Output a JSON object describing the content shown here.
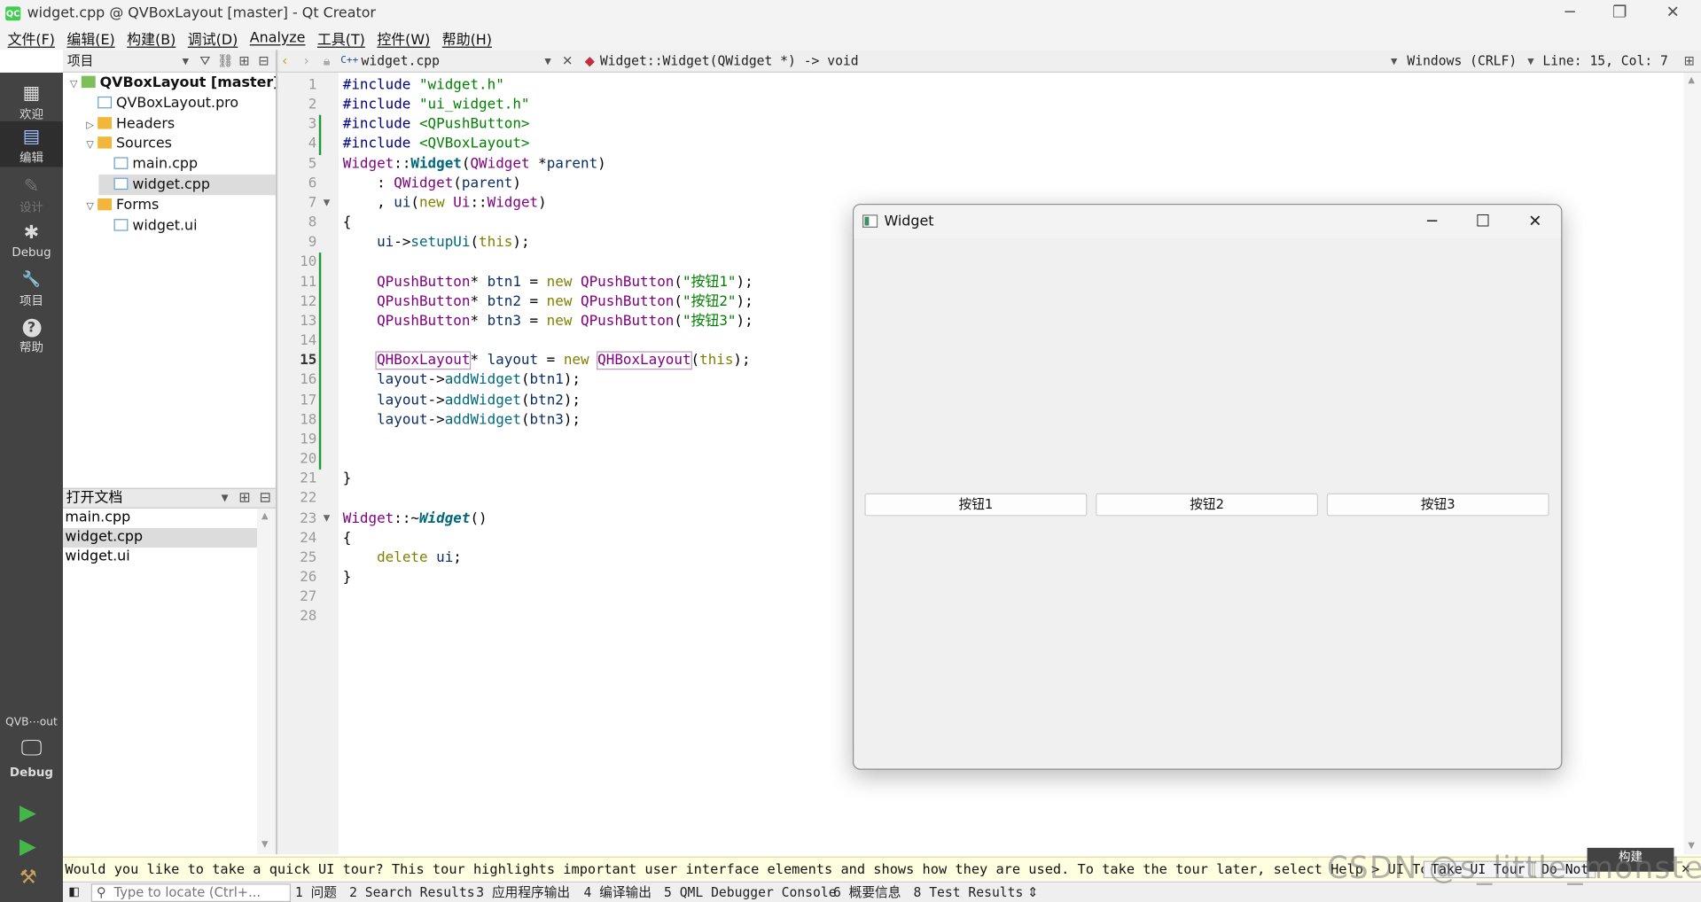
{
  "window": {
    "title": "widget.cpp @ QVBoxLayout [master] - Qt Creator",
    "logo": "QC",
    "min": "─",
    "max": "❐",
    "close": "✕"
  },
  "menu": [
    "文件(F)",
    "编辑(E)",
    "构建(B)",
    "调试(D)",
    "Analyze",
    "工具(T)",
    "控件(W)",
    "帮助(H)"
  ],
  "toolbar": {
    "panel": "项目",
    "file": "widget.cpp",
    "symbol": "Widget::Widget(QWidget *) -> void",
    "encoding": "Windows (CRLF)",
    "position": "Line: 15, Col: 7"
  },
  "modes": [
    {
      "icon": "grid-icon",
      "glyph": "▦",
      "label": "欢迎"
    },
    {
      "icon": "edit-icon",
      "glyph": "▤",
      "label": "编辑"
    },
    {
      "icon": "design-icon",
      "glyph": "✎",
      "label": "设计"
    },
    {
      "icon": "bug-icon",
      "glyph": "✱",
      "label": "Debug"
    },
    {
      "icon": "wrench-icon",
      "glyph": "🔧",
      "label": "项目"
    },
    {
      "icon": "help-icon",
      "glyph": "?",
      "label": "帮助"
    }
  ],
  "kit": {
    "name": "QVB⋯out",
    "label": "Debug"
  },
  "tree": [
    {
      "label": "QVBoxLayout [master]",
      "arrow": "▽",
      "indent": 0,
      "bold": true
    },
    {
      "label": "QVBoxLayout.pro",
      "arrow": "",
      "indent": 1
    },
    {
      "label": "Headers",
      "arrow": "▷",
      "indent": 1
    },
    {
      "label": "Sources",
      "arrow": "▽",
      "indent": 1
    },
    {
      "label": "main.cpp",
      "arrow": "",
      "indent": 2
    },
    {
      "label": "widget.cpp",
      "arrow": "",
      "indent": 2,
      "selected": true
    },
    {
      "label": "Forms",
      "arrow": "▽",
      "indent": 1
    },
    {
      "label": "widget.ui",
      "arrow": "",
      "indent": 2
    }
  ],
  "open_docs": {
    "title": "打开文档",
    "items": [
      "main.cpp",
      "widget.cpp",
      "widget.ui"
    ],
    "selected": 1
  },
  "code": {
    "lines": [
      "#include \"widget.h\"",
      "#include \"ui_widget.h\"",
      "#include <QPushButton>",
      "#include <QVBoxLayout>",
      "Widget::Widget(QWidget *parent)",
      "    : QWidget(parent)",
      "    , ui(new Ui::Widget)",
      "{",
      "    ui->setupUi(this);",
      "",
      "    QPushButton* btn1 = new QPushButton(\"按钮1\");",
      "    QPushButton* btn2 = new QPushButton(\"按钮2\");",
      "    QPushButton* btn3 = new QPushButton(\"按钮3\");",
      "",
      "    QHBoxLayout* layout = new QHBoxLayout(this);",
      "    layout->addWidget(btn1);",
      "    layout->addWidget(btn2);",
      "    layout->addWidget(btn3);",
      "",
      "",
      "}",
      "",
      "Widget::~Widget()",
      "{",
      "    delete ui;",
      "}",
      "",
      ""
    ],
    "current_line": 15
  },
  "running_widget": {
    "title": "Widget",
    "buttons": [
      "按钮1",
      "按钮2",
      "按钮3"
    ]
  },
  "infobar": {
    "text": "Would you like to take a quick UI tour? This tour highlights important user interface elements and shows how they are used. To take the tour later, select Help > UI Tour.",
    "take": "Take UI Tour",
    "dont": "Do Not"
  },
  "build_label": "构建",
  "status": {
    "locate_placeholder": "Type to locate (Ctrl+...",
    "tabs": [
      "1 问题",
      "2 Search Results",
      "3 应用程序输出",
      "4 编译输出",
      "5 QML Debugger Console",
      "6 概要信息",
      "8 Test Results"
    ]
  },
  "watermark": "CSDN @s_little_monster"
}
